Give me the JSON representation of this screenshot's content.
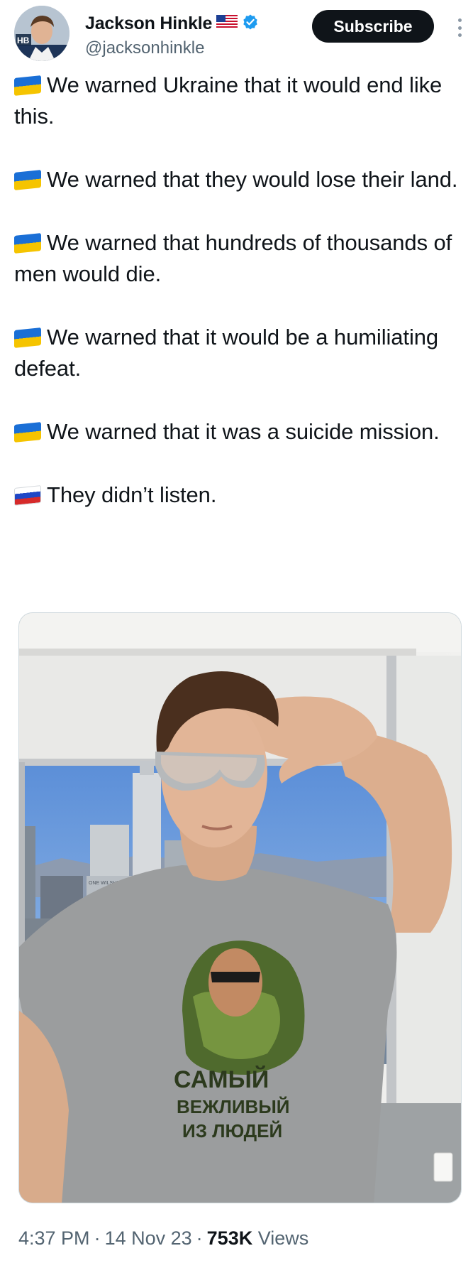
{
  "author": {
    "display_name": "Jackson Hinkle",
    "handle": "@jacksonhinkle",
    "flag_icon": "us-flag-icon",
    "verified_icon": "verified-badge-icon",
    "verified_color": "#1d9bf0",
    "avatar_badge_text": "HB"
  },
  "actions": {
    "subscribe_label": "Subscribe",
    "more_icon": "more-vertical-icon"
  },
  "tweet": {
    "lines": [
      {
        "flag": "ukraine-flag-icon",
        "text": "We warned Ukraine that it would end like this."
      },
      {
        "flag": "ukraine-flag-icon",
        "text": "We warned that they would lose their land."
      },
      {
        "flag": "ukraine-flag-icon",
        "text": "We warned that hundreds of thousands of men would die."
      },
      {
        "flag": "ukraine-flag-icon",
        "text": "We warned that it would be a humiliating defeat."
      },
      {
        "flag": "ukraine-flag-icon",
        "text": "We warned that it was a suicide mission."
      },
      {
        "flag": "russia-flag-icon",
        "text": "They didn’t listen."
      }
    ]
  },
  "media": {
    "image_icon": "selfie-photo",
    "shirt_text_line1": "САМЫЙ",
    "shirt_text_line2": "ВЕЖЛИВЫЙ",
    "shirt_text_line3": "ИЗ ЛЮДЕЙ",
    "building_sign": "ONE WILSHIRE"
  },
  "footer": {
    "time": "4:37 PM",
    "date": "14 Nov 23",
    "views_count": "753K",
    "views_label": "Views",
    "separator": "·"
  },
  "colors": {
    "text": "#0f1419",
    "secondary_text": "#536471",
    "button_bg": "#0f1419",
    "ukraine_blue": "#1a6fd6",
    "ukraine_yellow": "#f5c400",
    "russia_red": "#d62a2a"
  }
}
